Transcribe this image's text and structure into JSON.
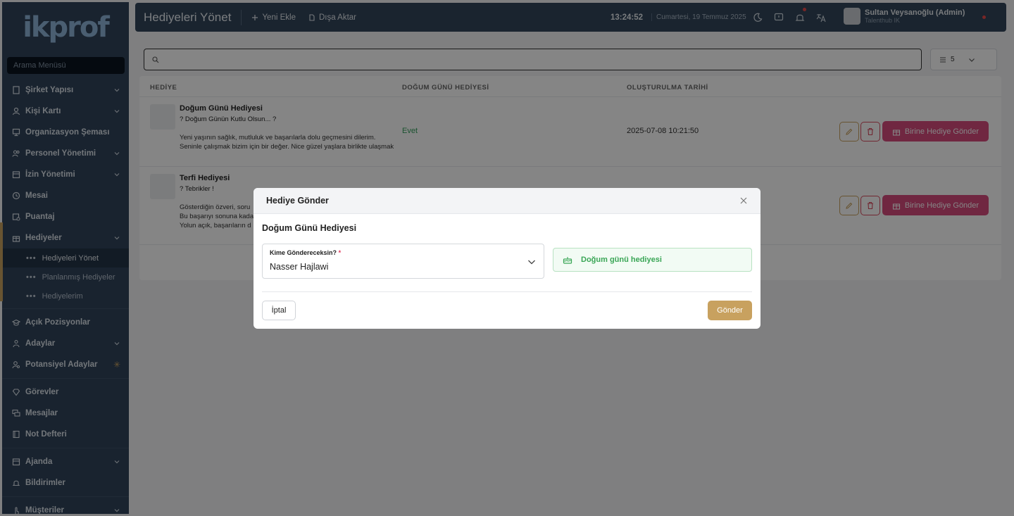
{
  "sidebar": {
    "logo": "ikprof",
    "search_placeholder": "Arama Menüsü",
    "items": [
      {
        "label": "Şirket Yapısı"
      },
      {
        "label": "Kişi Kartı"
      },
      {
        "label": "Organizasyon Şeması"
      },
      {
        "label": "Personel Yönetimi"
      },
      {
        "label": "İzin Yönetimi"
      },
      {
        "label": "Mesai"
      },
      {
        "label": "Puantaj"
      },
      {
        "label": "Hediyeler"
      },
      {
        "label": "Açık Pozisyonlar"
      },
      {
        "label": "Adaylar"
      },
      {
        "label": "Potansiyel Adaylar"
      },
      {
        "label": "Görevler"
      },
      {
        "label": "Mesajlar"
      },
      {
        "label": "Not Defteri"
      },
      {
        "label": "Ajanda"
      },
      {
        "label": "Bildirimler"
      },
      {
        "label": "Müşteriler"
      }
    ],
    "sub_items": [
      {
        "label": "Hediyeleri Yönet"
      },
      {
        "label": "Planlanmış Hediyeler"
      },
      {
        "label": "Hediyelerim"
      }
    ]
  },
  "header": {
    "title": "Hediyeleri Yönet",
    "add_label": "Yeni Ekle",
    "export_label": "Dışa Aktar",
    "clock": "13:24:52",
    "date": "Cumartesi, 19 Temmuz 2025",
    "user_name": "Sultan Veysanoğlu (Admin)",
    "user_role": "Talenthub IK"
  },
  "table": {
    "page_size": "5",
    "columns": [
      "HEDİYE",
      "DOĞUM GÜNÜ HEDİYESİ",
      "OLUŞTURULMA TARİHİ"
    ],
    "rows": [
      {
        "name": "Doğum Günü Hediyesi",
        "subtitle": "? Doğum Günün Kutlu Olsun... ?",
        "msg1": "Yeni yaşının sağlık, mutluluk ve başarılarla dolu geçmesini dilerim.",
        "msg2": "Seninle çalışmak bizim için bir değer. Nice güzel yaşlara birlikte ulaşmak",
        "birthday": "Evet",
        "created": "2025-07-08 10:21:50",
        "send_label": "Birine Hediye Gönder"
      },
      {
        "name": "Terfi Hediyesi",
        "subtitle": "? Tebrikler !",
        "msg1": "Gösterdiğin özveri, soru",
        "msg2": "Bu başarıyı sonuna kada",
        "msg3": "Yolun açık, başarıların d",
        "send_label": "Birine Hediye Gönder"
      }
    ]
  },
  "modal": {
    "title": "Hediye Gönder",
    "gift_name": "Doğum Günü Hediyesi",
    "recipient_label": "Kime Göndereceksin?",
    "required_mark": "*",
    "recipient_value": "Nasser Hajlawi",
    "badge_label": "Doğum günü hediyesi",
    "cancel_label": "İptal",
    "send_label": "Gönder"
  },
  "colors": {
    "sidebar_bg": "#31445a",
    "accent_gold": "#c8a15f",
    "accent_pink": "#d64b7e",
    "success_green": "#3aa656"
  }
}
